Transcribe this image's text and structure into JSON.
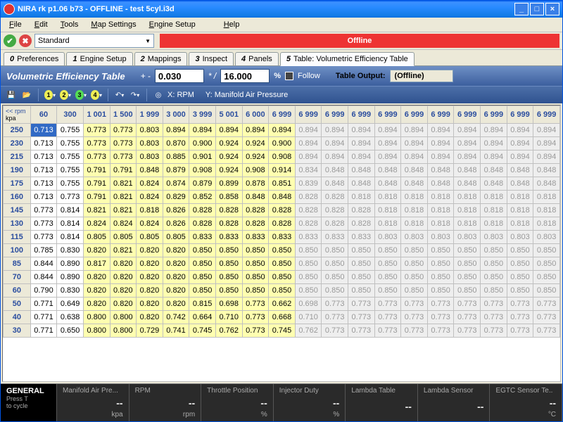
{
  "title": "NIRA rk p1.06 b73 - OFFLINE - test 5cyl.i3d",
  "menus": [
    "File",
    "Edit",
    "Tools",
    "Map Settings",
    "Engine Setup",
    "Help"
  ],
  "combo_value": "Standard",
  "offline_label": "Offline",
  "tabs": [
    {
      "num": "0",
      "label": "Preferences"
    },
    {
      "num": "1",
      "label": "Engine Setup"
    },
    {
      "num": "2",
      "label": "Mappings"
    },
    {
      "num": "3",
      "label": "Inspect"
    },
    {
      "num": "4",
      "label": "Panels"
    },
    {
      "num": "5",
      "label": "Table: Volumetric Efficiency Table"
    }
  ],
  "active_tab": 5,
  "sub": {
    "title": "Volumetric Efficiency Table",
    "pm_lbl": "+ -",
    "pm_val": "0.030",
    "sd_lbl": "* /",
    "sd_val": "16.000",
    "pct": "%",
    "follow": "Follow",
    "out_lbl": "Table Output:",
    "out_val": "(Offline)"
  },
  "axis": {
    "x": "X: RPM",
    "y": "Y: Manifold Air Pressure"
  },
  "corner": {
    "top": "<< rpm",
    "bottom": "kpa"
  },
  "x_headers": [
    "60",
    "300",
    "1 001",
    "1 500",
    "1 999",
    "3 000",
    "3 999",
    "5 001",
    "6 000",
    "6 999",
    "6 999",
    "6 999",
    "6 999",
    "6 999",
    "6 999",
    "6 999",
    "6 999",
    "6 999",
    "6 999",
    "6 999"
  ],
  "y_headers": [
    "250",
    "230",
    "215",
    "190",
    "175",
    "160",
    "145",
    "130",
    "115",
    "100",
    "85",
    "70",
    "60",
    "50",
    "40",
    "30"
  ],
  "chart_data": {
    "type": "table",
    "xlabel": "RPM",
    "ylabel": "Manifold Air Pressure (kPa)",
    "title": "Volumetric Efficiency Table",
    "x": [
      60,
      300,
      1001,
      1500,
      1999,
      3000,
      3999,
      5001,
      6000,
      6999,
      6999,
      6999,
      6999,
      6999,
      6999,
      6999,
      6999,
      6999,
      6999,
      6999
    ],
    "y": [
      250,
      230,
      215,
      190,
      175,
      160,
      145,
      130,
      115,
      100,
      85,
      70,
      60,
      50,
      40,
      30
    ],
    "values": [
      [
        0.713,
        0.755,
        0.773,
        0.773,
        0.803,
        0.894,
        0.894,
        0.894,
        0.894,
        0.894,
        0.894,
        0.894,
        0.894,
        0.894,
        0.894,
        0.894,
        0.894,
        0.894,
        0.894,
        0.894
      ],
      [
        0.713,
        0.755,
        0.773,
        0.773,
        0.803,
        0.87,
        0.9,
        0.924,
        0.924,
        0.9,
        0.894,
        0.894,
        0.894,
        0.894,
        0.894,
        0.894,
        0.894,
        0.894,
        0.894,
        0.894
      ],
      [
        0.713,
        0.755,
        0.773,
        0.773,
        0.803,
        0.885,
        0.901,
        0.924,
        0.924,
        0.908,
        0.894,
        0.894,
        0.894,
        0.894,
        0.894,
        0.894,
        0.894,
        0.894,
        0.894,
        0.894
      ],
      [
        0.713,
        0.755,
        0.791,
        0.791,
        0.848,
        0.879,
        0.908,
        0.924,
        0.908,
        0.914,
        0.834,
        0.848,
        0.848,
        0.848,
        0.848,
        0.848,
        0.848,
        0.848,
        0.848,
        0.848
      ],
      [
        0.713,
        0.755,
        0.791,
        0.821,
        0.824,
        0.874,
        0.879,
        0.899,
        0.878,
        0.851,
        0.839,
        0.848,
        0.848,
        0.848,
        0.848,
        0.848,
        0.848,
        0.848,
        0.848,
        0.848
      ],
      [
        0.713,
        0.773,
        0.791,
        0.821,
        0.824,
        0.829,
        0.852,
        0.858,
        0.848,
        0.848,
        0.828,
        0.828,
        0.818,
        0.818,
        0.818,
        0.818,
        0.818,
        0.818,
        0.818,
        0.818
      ],
      [
        0.773,
        0.814,
        0.821,
        0.821,
        0.818,
        0.826,
        0.828,
        0.828,
        0.828,
        0.828,
        0.828,
        0.828,
        0.828,
        0.818,
        0.818,
        0.818,
        0.818,
        0.818,
        0.818,
        0.818
      ],
      [
        0.773,
        0.814,
        0.824,
        0.824,
        0.824,
        0.826,
        0.828,
        0.828,
        0.828,
        0.828,
        0.828,
        0.828,
        0.828,
        0.818,
        0.818,
        0.818,
        0.818,
        0.818,
        0.818,
        0.818
      ],
      [
        0.773,
        0.814,
        0.805,
        0.805,
        0.805,
        0.805,
        0.833,
        0.833,
        0.833,
        0.833,
        0.833,
        0.833,
        0.833,
        0.803,
        0.803,
        0.803,
        0.803,
        0.803,
        0.803,
        0.803
      ],
      [
        0.785,
        0.83,
        0.82,
        0.821,
        0.82,
        0.82,
        0.85,
        0.85,
        0.85,
        0.85,
        0.85,
        0.85,
        0.85,
        0.85,
        0.85,
        0.85,
        0.85,
        0.85,
        0.85,
        0.85
      ],
      [
        0.844,
        0.89,
        0.817,
        0.82,
        0.82,
        0.82,
        0.85,
        0.85,
        0.85,
        0.85,
        0.85,
        0.85,
        0.85,
        0.85,
        0.85,
        0.85,
        0.85,
        0.85,
        0.85,
        0.85
      ],
      [
        0.844,
        0.89,
        0.82,
        0.82,
        0.82,
        0.82,
        0.85,
        0.85,
        0.85,
        0.85,
        0.85,
        0.85,
        0.85,
        0.85,
        0.85,
        0.85,
        0.85,
        0.85,
        0.85,
        0.85
      ],
      [
        0.79,
        0.83,
        0.82,
        0.82,
        0.82,
        0.82,
        0.85,
        0.85,
        0.85,
        0.85,
        0.85,
        0.85,
        0.85,
        0.85,
        0.85,
        0.85,
        0.85,
        0.85,
        0.85,
        0.85
      ],
      [
        0.771,
        0.649,
        0.82,
        0.82,
        0.82,
        0.82,
        0.815,
        0.698,
        0.773,
        0.662,
        0.698,
        0.773,
        0.773,
        0.773,
        0.773,
        0.773,
        0.773,
        0.773,
        0.773,
        0.773
      ],
      [
        0.771,
        0.638,
        0.8,
        0.8,
        0.82,
        0.742,
        0.664,
        0.71,
        0.773,
        0.668,
        0.71,
        0.773,
        0.773,
        0.773,
        0.773,
        0.773,
        0.773,
        0.773,
        0.773,
        0.773
      ],
      [
        0.771,
        0.65,
        0.8,
        0.8,
        0.729,
        0.741,
        0.745,
        0.762,
        0.773,
        0.745,
        0.762,
        0.773,
        0.773,
        0.773,
        0.773,
        0.773,
        0.773,
        0.773,
        0.773,
        0.773
      ]
    ],
    "active_cols": 10,
    "selected": {
      "row": 0,
      "col": 0
    }
  },
  "status": {
    "general": "GENERAL",
    "general_sub1": "Press T",
    "general_sub2": "to cycle",
    "items": [
      {
        "label": "Manifold Air Pre...",
        "val": "--",
        "unit": "kpa"
      },
      {
        "label": "RPM",
        "val": "--",
        "unit": "rpm"
      },
      {
        "label": "Throttle Position",
        "val": "--",
        "unit": "%"
      },
      {
        "label": "Injector Duty",
        "val": "--",
        "unit": "%"
      },
      {
        "label": "Lambda Table",
        "val": "--",
        "unit": ""
      },
      {
        "label": "Lambda Sensor",
        "val": "--",
        "unit": ""
      },
      {
        "label": "EGTC Sensor Te..",
        "val": "--",
        "unit": "°C"
      }
    ]
  }
}
